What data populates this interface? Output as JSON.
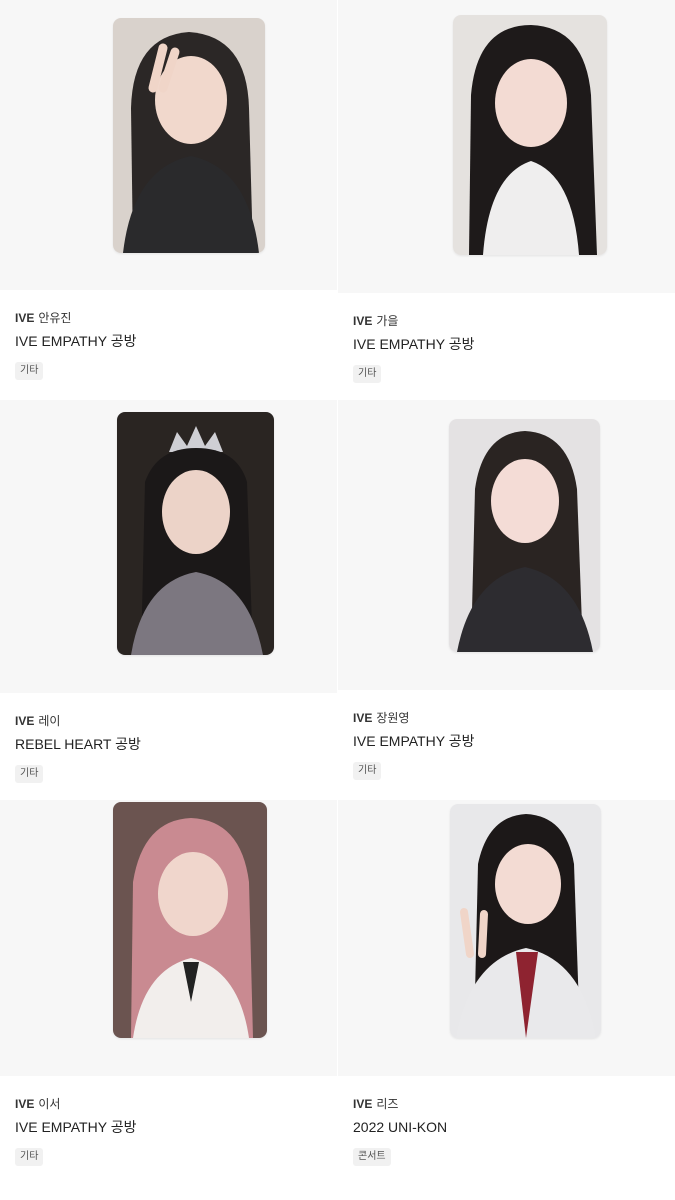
{
  "cards": [
    {
      "group": "IVE",
      "member": "안유진",
      "album": "IVE EMPATHY 공방",
      "tag": "기타",
      "photo_icon": "photocard-image",
      "hair": "#2b2726",
      "bg": "#d9d2cc",
      "outfit": "#2a2a2c"
    },
    {
      "group": "IVE",
      "member": "가을",
      "album": "IVE EMPATHY 공방",
      "tag": "기타",
      "photo_icon": "photocard-image",
      "hair": "#1e1a1a",
      "bg": "#e5e2df",
      "outfit": "#efeeee"
    },
    {
      "group": "IVE",
      "member": "레이",
      "album": "REBEL HEART 공방",
      "tag": "기타",
      "photo_icon": "photocard-image",
      "hair": "#1b1818",
      "bg": "#2a2522",
      "outfit": "#7c7780"
    },
    {
      "group": "IVE",
      "member": "장원영",
      "album": "IVE EMPATHY 공방",
      "tag": "기타",
      "photo_icon": "photocard-image",
      "hair": "#2a2422",
      "bg": "#e4e2e3",
      "outfit": "#2d2c30"
    },
    {
      "group": "IVE",
      "member": "이서",
      "album": "IVE EMPATHY 공방",
      "tag": "기타",
      "photo_icon": "photocard-image",
      "hair": "#c98a91",
      "bg": "#6b5450",
      "outfit": "#f2eeec"
    },
    {
      "group": "IVE",
      "member": "리즈",
      "album": "2022 UNI-KON",
      "tag": "콘서트",
      "photo_icon": "photocard-image",
      "hair": "#1c1818",
      "bg": "#e8e8ea",
      "outfit": "#e9e9eb"
    }
  ]
}
